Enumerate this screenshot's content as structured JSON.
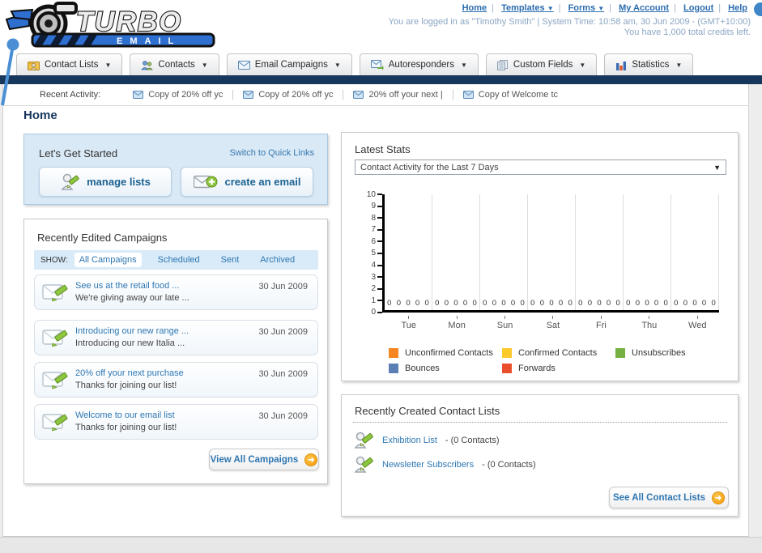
{
  "colors": {
    "navy_bar": "#17375c",
    "link_blue": "#2e77b2",
    "panel_blue_bg": "#d9e9f6",
    "arrow_orange": "#f5a623"
  },
  "header": {
    "logo_title": "TURBO",
    "logo_subtitle": "E M A I L",
    "links": [
      {
        "label": "Home",
        "dropdown": false
      },
      {
        "label": "Templates",
        "dropdown": true
      },
      {
        "label": "Forms",
        "dropdown": true
      },
      {
        "label": "My Account",
        "dropdown": false
      },
      {
        "label": "Logout",
        "dropdown": false
      },
      {
        "label": "Help",
        "dropdown": false
      }
    ],
    "status_line": "You are logged in as \"Timothy Smith\" | System Time: 10:58 am, 30 Jun 2009 - (GMT+10:00)",
    "credits_line": "You have 1,000 total credits left."
  },
  "nav": {
    "tabs": [
      {
        "label": "Contact Lists",
        "icon": "folder-user-icon"
      },
      {
        "label": "Contacts",
        "icon": "users-icon"
      },
      {
        "label": "Email Campaigns",
        "icon": "envelope-icon"
      },
      {
        "label": "Autoresponders",
        "icon": "envelope-arrow-icon"
      },
      {
        "label": "Custom Fields",
        "icon": "documents-icon"
      },
      {
        "label": "Statistics",
        "icon": "bar-chart-icon"
      }
    ]
  },
  "recent_activity": {
    "label": "Recent Activity:",
    "items": [
      {
        "text": "Copy of 20% off yc",
        "icon": "envelope-icon"
      },
      {
        "text": "Copy of 20% off yc",
        "icon": "envelope-icon"
      },
      {
        "text": "20% off your next |",
        "icon": "envelope-icon"
      },
      {
        "text": "Copy of Welcome tc",
        "icon": "envelope-icon"
      }
    ]
  },
  "page_title": "Home",
  "get_started": {
    "title": "Let's Get Started",
    "switch_link": "Switch to Quick Links",
    "buttons": [
      {
        "label": "manage lists",
        "icon": "person-pencil-icon"
      },
      {
        "label": "create an email",
        "icon": "envelope-plus-icon"
      }
    ]
  },
  "campaigns": {
    "title": "Recently Edited Campaigns",
    "show_label": "SHOW:",
    "filters": [
      "All Campaigns",
      "Scheduled",
      "Sent",
      "Archived"
    ],
    "active_filter": "All Campaigns",
    "items": [
      {
        "title": "See us at the retail food ...",
        "subtitle": "We're giving away our late ...",
        "date": "30 Jun 2009",
        "icon": "envelope-pencil-icon"
      },
      {
        "title": "Introducing our new range ...",
        "subtitle": "Introducing our new Italia ...",
        "date": "30 Jun 2009",
        "icon": "envelope-pencil-icon"
      },
      {
        "title": "20% off your next purchase",
        "subtitle": "Thanks for joining our list!",
        "date": "30 Jun 2009",
        "icon": "envelope-pencil-icon"
      },
      {
        "title": "Welcome to our email list",
        "subtitle": "Thanks for joining our list!",
        "date": "30 Jun 2009",
        "icon": "envelope-pencil-icon"
      }
    ],
    "view_all_label": "View All Campaigns"
  },
  "latest_stats": {
    "title": "Latest Stats",
    "dropdown_value": "Contact Activity for the Last 7 Days"
  },
  "chart_data": {
    "type": "bar",
    "title": "Contact Activity for the Last 7 Days",
    "categories": [
      "Tue",
      "Mon",
      "Sun",
      "Sat",
      "Fri",
      "Thu",
      "Wed"
    ],
    "series": [
      {
        "name": "Unconfirmed Contacts",
        "color": "#f6861f",
        "values": [
          0,
          0,
          0,
          0,
          0,
          0,
          0
        ]
      },
      {
        "name": "Confirmed Contacts",
        "color": "#fdc92b",
        "values": [
          0,
          0,
          0,
          0,
          0,
          0,
          0
        ]
      },
      {
        "name": "Unsubscribes",
        "color": "#76b043",
        "values": [
          0,
          0,
          0,
          0,
          0,
          0,
          0
        ]
      },
      {
        "name": "Bounces",
        "color": "#5b7fb4",
        "values": [
          0,
          0,
          0,
          0,
          0,
          0,
          0
        ]
      },
      {
        "name": "Forwards",
        "color": "#ea4f2c",
        "values": [
          0,
          0,
          0,
          0,
          0,
          0,
          0
        ]
      }
    ],
    "xlabel": "",
    "ylabel": "",
    "ylim": [
      0,
      10
    ],
    "yticks": [
      0,
      1,
      2,
      3,
      4,
      5,
      6,
      7,
      8,
      9,
      10
    ],
    "grid": true,
    "legend_position": "bottom"
  },
  "contact_lists": {
    "title": "Recently Created Contact Lists",
    "items": [
      {
        "name": "Exhibition List",
        "detail": "- (0 Contacts)",
        "icon": "person-pencil-icon"
      },
      {
        "name": "Newsletter Subscribers",
        "detail": "- (0 Contacts)",
        "icon": "person-pencil-icon"
      }
    ],
    "see_all_label": "See All Contact Lists"
  }
}
